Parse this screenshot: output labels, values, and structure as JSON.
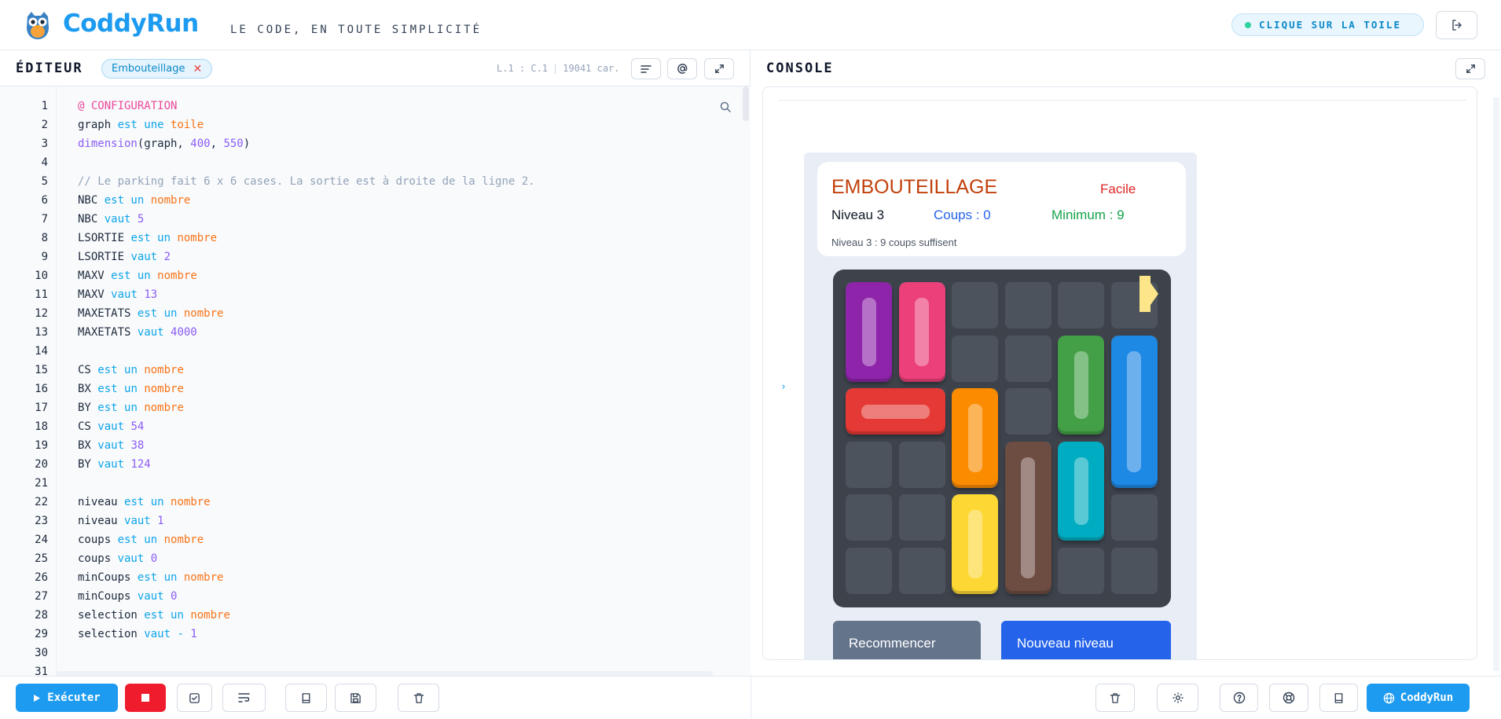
{
  "header": {
    "brand": "CoddyRun",
    "tagline": "LE CODE, EN TOUTE SIMPLICITÉ",
    "hint": "CLIQUE SUR LA TOILE"
  },
  "editor": {
    "title": "ÉDITEUR",
    "file_tab": "Embouteillage",
    "cursor_pos": "L.1 : C.1",
    "char_count": "19041 car.",
    "code_lines": [
      {
        "n": "1",
        "tokens": [
          {
            "t": "@ CONFIGURATION",
            "c": "at"
          }
        ]
      },
      {
        "n": "2",
        "tokens": [
          {
            "t": "graph ",
            "c": ""
          },
          {
            "t": "est une ",
            "c": "kw"
          },
          {
            "t": "toile",
            "c": "ty"
          }
        ]
      },
      {
        "n": "3",
        "tokens": [
          {
            "t": "dimension",
            "c": "fn"
          },
          {
            "t": "(graph, ",
            "c": ""
          },
          {
            "t": "400",
            "c": "num"
          },
          {
            "t": ", ",
            "c": ""
          },
          {
            "t": "550",
            "c": "num"
          },
          {
            "t": ")",
            "c": ""
          }
        ]
      },
      {
        "n": "4",
        "tokens": []
      },
      {
        "n": "5",
        "tokens": [
          {
            "t": "// Le parking fait 6 x 6 cases. La sortie est à droite de la ligne 2.",
            "c": "cm"
          }
        ]
      },
      {
        "n": "6",
        "tokens": [
          {
            "t": "NBC ",
            "c": ""
          },
          {
            "t": "est un ",
            "c": "kw"
          },
          {
            "t": "nombre",
            "c": "ty"
          }
        ]
      },
      {
        "n": "7",
        "tokens": [
          {
            "t": "NBC ",
            "c": ""
          },
          {
            "t": "vaut ",
            "c": "kw"
          },
          {
            "t": "5",
            "c": "num"
          }
        ]
      },
      {
        "n": "8",
        "tokens": [
          {
            "t": "LSORTIE ",
            "c": ""
          },
          {
            "t": "est un ",
            "c": "kw"
          },
          {
            "t": "nombre",
            "c": "ty"
          }
        ]
      },
      {
        "n": "9",
        "tokens": [
          {
            "t": "LSORTIE ",
            "c": ""
          },
          {
            "t": "vaut ",
            "c": "kw"
          },
          {
            "t": "2",
            "c": "num"
          }
        ]
      },
      {
        "n": "10",
        "tokens": [
          {
            "t": "MAXV ",
            "c": ""
          },
          {
            "t": "est un ",
            "c": "kw"
          },
          {
            "t": "nombre",
            "c": "ty"
          }
        ]
      },
      {
        "n": "11",
        "tokens": [
          {
            "t": "MAXV ",
            "c": ""
          },
          {
            "t": "vaut ",
            "c": "kw"
          },
          {
            "t": "13",
            "c": "num"
          }
        ]
      },
      {
        "n": "12",
        "tokens": [
          {
            "t": "MAXETATS ",
            "c": ""
          },
          {
            "t": "est un ",
            "c": "kw"
          },
          {
            "t": "nombre",
            "c": "ty"
          }
        ]
      },
      {
        "n": "13",
        "tokens": [
          {
            "t": "MAXETATS ",
            "c": ""
          },
          {
            "t": "vaut ",
            "c": "kw"
          },
          {
            "t": "4000",
            "c": "num"
          }
        ]
      },
      {
        "n": "14",
        "tokens": []
      },
      {
        "n": "15",
        "tokens": [
          {
            "t": "CS ",
            "c": ""
          },
          {
            "t": "est un ",
            "c": "kw"
          },
          {
            "t": "nombre",
            "c": "ty"
          }
        ]
      },
      {
        "n": "16",
        "tokens": [
          {
            "t": "BX ",
            "c": ""
          },
          {
            "t": "est un ",
            "c": "kw"
          },
          {
            "t": "nombre",
            "c": "ty"
          }
        ]
      },
      {
        "n": "17",
        "tokens": [
          {
            "t": "BY ",
            "c": ""
          },
          {
            "t": "est un ",
            "c": "kw"
          },
          {
            "t": "nombre",
            "c": "ty"
          }
        ]
      },
      {
        "n": "18",
        "tokens": [
          {
            "t": "CS ",
            "c": ""
          },
          {
            "t": "vaut ",
            "c": "kw"
          },
          {
            "t": "54",
            "c": "num"
          }
        ]
      },
      {
        "n": "19",
        "tokens": [
          {
            "t": "BX ",
            "c": ""
          },
          {
            "t": "vaut ",
            "c": "kw"
          },
          {
            "t": "38",
            "c": "num"
          }
        ]
      },
      {
        "n": "20",
        "tokens": [
          {
            "t": "BY ",
            "c": ""
          },
          {
            "t": "vaut ",
            "c": "kw"
          },
          {
            "t": "124",
            "c": "num"
          }
        ]
      },
      {
        "n": "21",
        "tokens": []
      },
      {
        "n": "22",
        "tokens": [
          {
            "t": "niveau ",
            "c": ""
          },
          {
            "t": "est un ",
            "c": "kw"
          },
          {
            "t": "nombre",
            "c": "ty"
          }
        ]
      },
      {
        "n": "23",
        "tokens": [
          {
            "t": "niveau ",
            "c": ""
          },
          {
            "t": "vaut ",
            "c": "kw"
          },
          {
            "t": "1",
            "c": "num"
          }
        ]
      },
      {
        "n": "24",
        "tokens": [
          {
            "t": "coups ",
            "c": ""
          },
          {
            "t": "est un ",
            "c": "kw"
          },
          {
            "t": "nombre",
            "c": "ty"
          }
        ]
      },
      {
        "n": "25",
        "tokens": [
          {
            "t": "coups ",
            "c": ""
          },
          {
            "t": "vaut ",
            "c": "kw"
          },
          {
            "t": "0",
            "c": "num"
          }
        ]
      },
      {
        "n": "26",
        "tokens": [
          {
            "t": "minCoups ",
            "c": ""
          },
          {
            "t": "est un ",
            "c": "kw"
          },
          {
            "t": "nombre",
            "c": "ty"
          }
        ]
      },
      {
        "n": "27",
        "tokens": [
          {
            "t": "minCoups ",
            "c": ""
          },
          {
            "t": "vaut ",
            "c": "kw"
          },
          {
            "t": "0",
            "c": "num"
          }
        ]
      },
      {
        "n": "28",
        "tokens": [
          {
            "t": "selection ",
            "c": ""
          },
          {
            "t": "est un ",
            "c": "kw"
          },
          {
            "t": "nombre",
            "c": "ty"
          }
        ]
      },
      {
        "n": "29",
        "tokens": [
          {
            "t": "selection ",
            "c": ""
          },
          {
            "t": "vaut - ",
            "c": "kw"
          },
          {
            "t": "1",
            "c": "num"
          }
        ]
      },
      {
        "n": "30",
        "tokens": []
      },
      {
        "n": "31",
        "tokens": []
      }
    ]
  },
  "console": {
    "title": "CONSOLE",
    "prompt": "›",
    "game": {
      "title": "EMBOUTEILLAGE",
      "difficulty": "Facile",
      "level": "Niveau 3",
      "moves": "Coups : 0",
      "minimum": "Minimum : 9",
      "note": "Niveau 3 : 9 coups suffisent",
      "restart_label": "Recommencer",
      "new_level_label": "Nouveau niveau",
      "board": {
        "rows": 6,
        "cols": 6,
        "exit_row": 2,
        "cars": [
          {
            "color": "#8e24aa",
            "row": 0,
            "col": 0,
            "len": 2,
            "dir": "v"
          },
          {
            "color": "#ec407a",
            "row": 0,
            "col": 1,
            "len": 2,
            "dir": "v"
          },
          {
            "color": "#43a047",
            "row": 1,
            "col": 4,
            "len": 2,
            "dir": "v"
          },
          {
            "color": "#1e88e5",
            "row": 1,
            "col": 5,
            "len": 3,
            "dir": "v"
          },
          {
            "color": "#e53935",
            "row": 2,
            "col": 0,
            "len": 2,
            "dir": "h"
          },
          {
            "color": "#fb8c00",
            "row": 2,
            "col": 2,
            "len": 2,
            "dir": "v"
          },
          {
            "color": "#6d4c41",
            "row": 3,
            "col": 3,
            "len": 3,
            "dir": "v"
          },
          {
            "color": "#00acc1",
            "row": 3,
            "col": 4,
            "len": 2,
            "dir": "v"
          },
          {
            "color": "#fdd835",
            "row": 4,
            "col": 2,
            "len": 2,
            "dir": "v"
          }
        ]
      }
    }
  },
  "footer": {
    "run_label": "Exécuter",
    "coddyrun_label": "CoddyRun"
  },
  "colors": {
    "accent": "#1d9bf0",
    "stop": "#ef1c2e",
    "restart_btn": "#64748b",
    "new_level_btn": "#2563eb"
  }
}
